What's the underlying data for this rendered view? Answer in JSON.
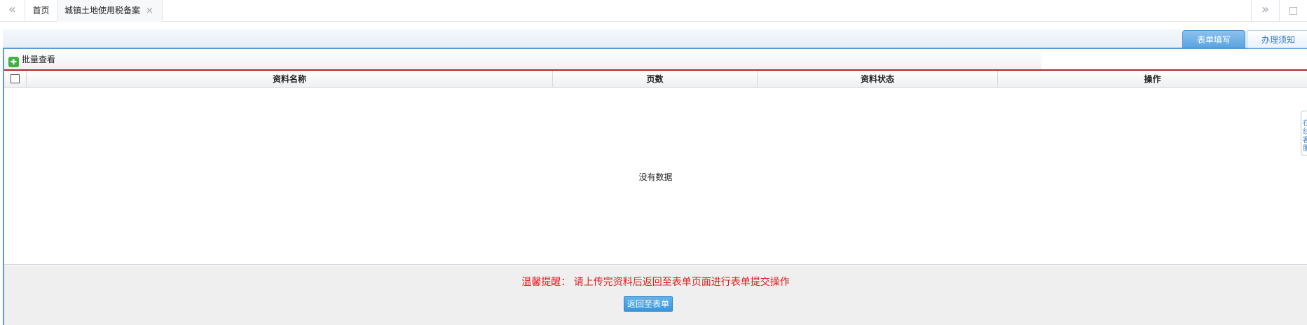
{
  "topbar": {
    "nav_left": "«",
    "tabs": [
      {
        "label": "首页"
      },
      {
        "label": "城镇土地使用税备案",
        "close": "×"
      }
    ],
    "nav_right_more": "»",
    "maximize": "□"
  },
  "subtabs": {
    "fill": "表单填写",
    "notice": "办理须知"
  },
  "toolbar": {
    "batch_view": "批量查看",
    "batch_icon": "check-plus-icon"
  },
  "grid": {
    "columns": [
      "资料名称",
      "页数",
      "资料状态",
      "操作"
    ],
    "rows": [],
    "empty_text": "没有数据"
  },
  "footer": {
    "reminder": "温馨提醒：  请上传完资料后返回至表单页面进行表单提交操作",
    "back_button": "返回至表单"
  },
  "side_tab": "在线客服",
  "colors": {
    "accent_blue": "#5a9bd5",
    "header_red_line": "#b3262a",
    "reminder_red": "#e02020",
    "button_blue": "#3a95dc"
  }
}
